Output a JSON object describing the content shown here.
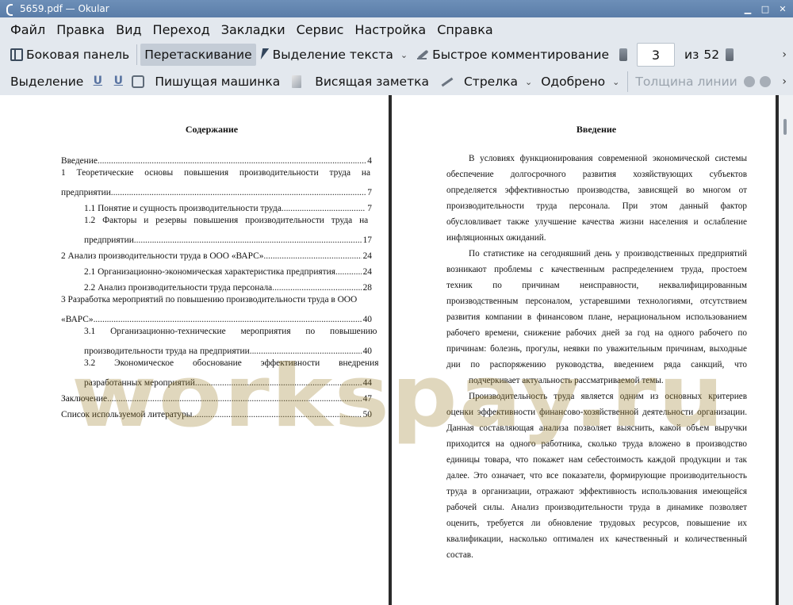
{
  "window": {
    "title": "5659.pdf  — Okular",
    "controls": {
      "minimize": "▁",
      "maximize": "□",
      "close": "✕"
    }
  },
  "menu": [
    "Файл",
    "Правка",
    "Вид",
    "Переход",
    "Закладки",
    "Сервис",
    "Настройка",
    "Справка"
  ],
  "toolbar1": {
    "sidebar": "Боковая панель",
    "drag": "Перетаскивание",
    "text_select": "Выделение текста",
    "quick_comment": "Быстрое комментирование",
    "page_current": "3",
    "page_of": "из",
    "page_total": "52",
    "more": "›"
  },
  "toolbar2": {
    "select": "Выделение",
    "typewriter": "Пишущая машинка",
    "sticky_note": "Висящая заметка",
    "arrow": "Стрелка",
    "approved": "Одобрено",
    "line_width": "Толщина линии",
    "more": "›"
  },
  "left_page": {
    "title": "Содержание",
    "toc": [
      {
        "text": "Введение",
        "page": "4"
      },
      {
        "text_a": "1 Теоретические основы повышения производительности труда на",
        "text_b": "предприятии",
        "page": "7"
      },
      {
        "text": "1.1 Понятие и сущность производительности труда",
        "page": "7"
      },
      {
        "text_a": "1.2 Факторы и резервы повышения производительности труда на",
        "text_b": "предприятии",
        "page": "17"
      },
      {
        "text": "2 Анализ производительности труда в ООО «ВАРС»",
        "page": "24"
      },
      {
        "text": "2.1 Организационно-экономическая характеристика предприятия",
        "page": "24"
      },
      {
        "text": "2.2 Анализ производительности труда персонала",
        "page": "28"
      },
      {
        "text_a": "3 Разработка мероприятий по повышению производительности труда в ООО",
        "text_b": "«ВАРС»",
        "page": "40"
      },
      {
        "text_a": "3.1 Организационно-технические мероприятия по повышению",
        "text_b": "производительности труда на предприятии",
        "page": "40"
      },
      {
        "text_a": "3.2 Экономическое обоснование эффективности внедрения",
        "text_b": "разработанных мероприятий",
        "page": "44"
      },
      {
        "text": "Заключение",
        "page": "47"
      },
      {
        "text": "Список используемой литературы",
        "page": "50"
      }
    ]
  },
  "right_page": {
    "title": "Введение",
    "lines": [
      "В условиях функционирования современной экономической системы",
      "обеспечение долгосрочного развития хозяйствующих субъектов",
      "определяется эффективностью производства, зависящей во многом от",
      "производительности труда персонала. При этом данный фактор",
      "обусловливает также улучшение качества жизни населения и ослабление",
      "инфляционных ожиданий.",
      "По статистике на сегодняшний день у производственных предприятий",
      "возникают проблемы с качественным распределением труда, простоем",
      "техник по причинам неисправности, неквалифицированным",
      "производственным персоналом, устаревшими технологиями, отсутствием",
      "развития компании в финансовом плане, нерациональном использованием",
      "рабочего времени, снижение рабочих дней за год на одного рабочего по",
      "причинам: болезнь, прогулы, неявки по уважительным причинам, выходные",
      "дни по распоряжению руководства, введением ряда санкций, что",
      "подчеркивает актуальность рассматриваемой темы.",
      "Производительность труда является одним из основных критериев",
      "оценки эффективности финансово-хозяйственной деятельности организации.",
      "Данная составляющая анализа позволяет выяснить, какой объем выручки",
      "приходится на одного работника, сколько труда вложено в производство",
      "единицы товара, что покажет нам себестоимость каждой продукции и так",
      "далее. Это означает, что все показатели, формирующие производительность",
      "труда в организации, отражают эффективность использования имеющейся",
      "рабочей силы. Анализ производительности труда в динамике позволяет",
      "оценить, требуется ли обновление трудовых ресурсов, повышение их",
      "квалификации, насколько оптимален их качественный и количественный",
      "состав."
    ]
  },
  "watermark": "workspay.ru"
}
